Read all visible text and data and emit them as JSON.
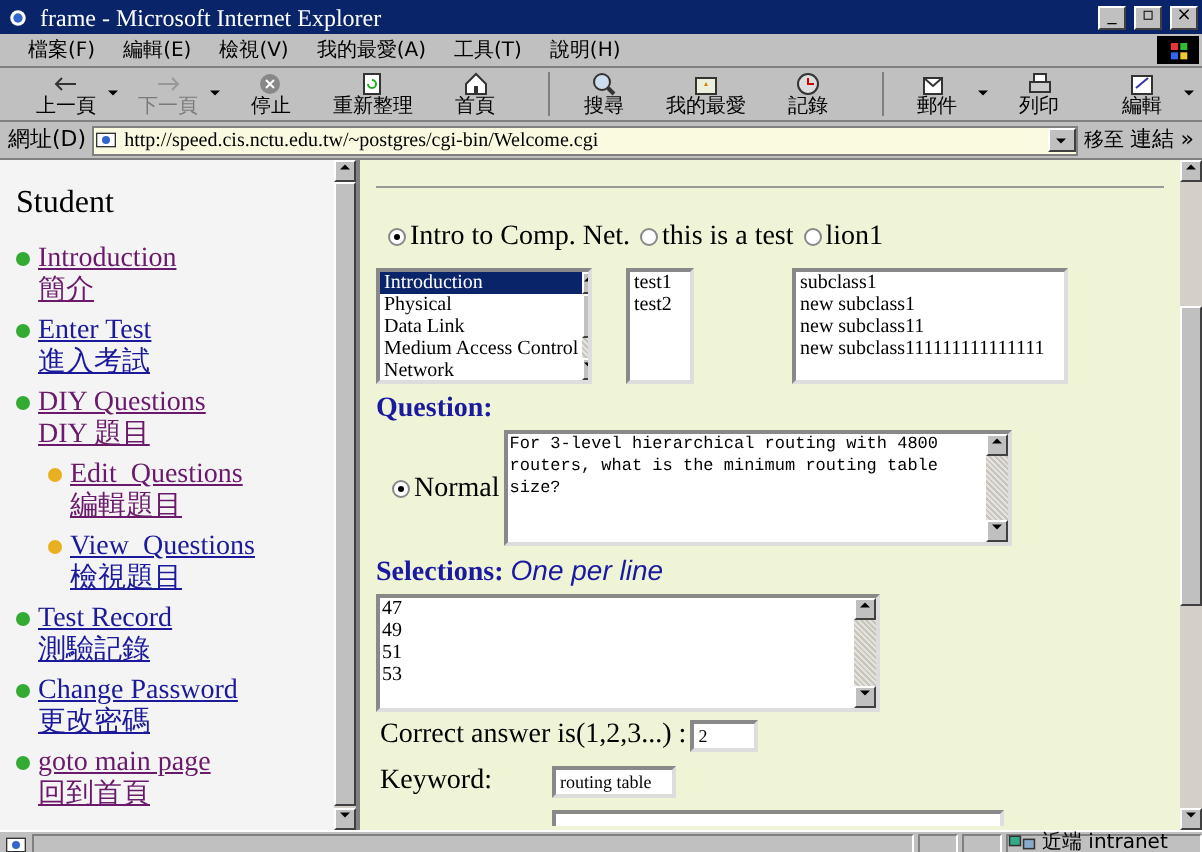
{
  "window": {
    "title": "frame - Microsoft Internet Explorer",
    "controls": [
      "_",
      "▫",
      "×"
    ]
  },
  "menu": [
    "檔案(F)",
    "編輯(E)",
    "檢視(V)",
    "我的最愛(A)",
    "工具(T)",
    "說明(H)"
  ],
  "toolbar": [
    {
      "label": "上一頁",
      "kind": "back",
      "disabled": false,
      "dropdown": true
    },
    {
      "label": "下一頁",
      "kind": "forward",
      "disabled": true,
      "dropdown": true
    },
    {
      "label": "停止",
      "kind": "stop",
      "disabled": false,
      "dropdown": false
    },
    {
      "label": "重新整理",
      "kind": "refresh",
      "disabled": false,
      "dropdown": false
    },
    {
      "label": "首頁",
      "kind": "home",
      "disabled": false,
      "dropdown": false
    },
    {
      "label": "搜尋",
      "kind": "search",
      "disabled": false,
      "dropdown": false
    },
    {
      "label": "我的最愛",
      "kind": "favorites",
      "disabled": false,
      "dropdown": false
    },
    {
      "label": "記錄",
      "kind": "history",
      "disabled": false,
      "dropdown": false
    },
    {
      "label": "郵件",
      "kind": "mail",
      "disabled": false,
      "dropdown": true
    },
    {
      "label": "列印",
      "kind": "print",
      "disabled": false,
      "dropdown": false
    },
    {
      "label": "編輯",
      "kind": "edit",
      "disabled": false,
      "dropdown": true
    }
  ],
  "address": {
    "label": "網址(D)",
    "url": "http://speed.cis.nctu.edu.tw/~postgres/cgi-bin/Welcome.cgi",
    "go": "移至",
    "links": "連結 »"
  },
  "sidebar": {
    "title": "Student",
    "items": [
      {
        "label": "Introduction",
        "label_zh": "簡介",
        "visited": true,
        "color": "#33aa33"
      },
      {
        "label": "Enter Test",
        "label_zh": "進入考試",
        "visited": false,
        "color": "#33aa33"
      },
      {
        "label": "DIY Questions",
        "label_zh": "DIY 題目",
        "visited": true,
        "color": "#33aa33",
        "children": [
          {
            "label": "Edit_Questions",
            "label_zh": "編輯題目",
            "visited": true,
            "color": "#e8b020"
          },
          {
            "label": "View_Questions",
            "label_zh": "檢視題目",
            "visited": false,
            "color": "#e8b020"
          }
        ]
      },
      {
        "label": "Test Record",
        "label_zh": "測驗記錄",
        "visited": false,
        "color": "#33aa33"
      },
      {
        "label": "Change Password",
        "label_zh": "更改密碼",
        "visited": false,
        "color": "#33aa33"
      },
      {
        "label": "goto main page",
        "label_zh": "回到首頁",
        "visited": true,
        "color": "#33aa33"
      }
    ]
  },
  "courses": [
    {
      "label": "Intro to Comp. Net.",
      "selected": true
    },
    {
      "label": "this is a test",
      "selected": false
    },
    {
      "label": "lion1",
      "selected": false
    }
  ],
  "lists": [
    {
      "items": [
        {
          "text": "Introduction",
          "selected": true
        },
        {
          "text": "Physical",
          "selected": false
        },
        {
          "text": "Data Link",
          "selected": false
        },
        {
          "text": "Medium Access Control",
          "selected": false
        },
        {
          "text": "Network",
          "selected": false
        }
      ]
    },
    {
      "items": [
        {
          "text": "test1",
          "selected": false
        },
        {
          "text": "test2",
          "selected": false
        }
      ]
    },
    {
      "items": [
        {
          "text": "subclass1",
          "selected": false
        },
        {
          "text": "new subclass1",
          "selected": false
        },
        {
          "text": "new subclass11",
          "selected": false
        },
        {
          "text": "new subclass111111111111111",
          "selected": false
        }
      ]
    }
  ],
  "question": {
    "heading": "Question:",
    "type_label": "Normal",
    "type_selected": true,
    "text": "For 3-level hierarchical routing with 4800 routers, what is the minimum routing table size?"
  },
  "selections": {
    "heading": "Selections:",
    "hint": "One per line",
    "lines": [
      "47",
      "49",
      "51",
      "53"
    ]
  },
  "correct": {
    "label": "Correct answer is(1,2,3...) :",
    "value": "2"
  },
  "keyword": {
    "label": "Keyword:",
    "value": "routing table"
  },
  "status_bar": {
    "zone": "近端 intranet"
  }
}
